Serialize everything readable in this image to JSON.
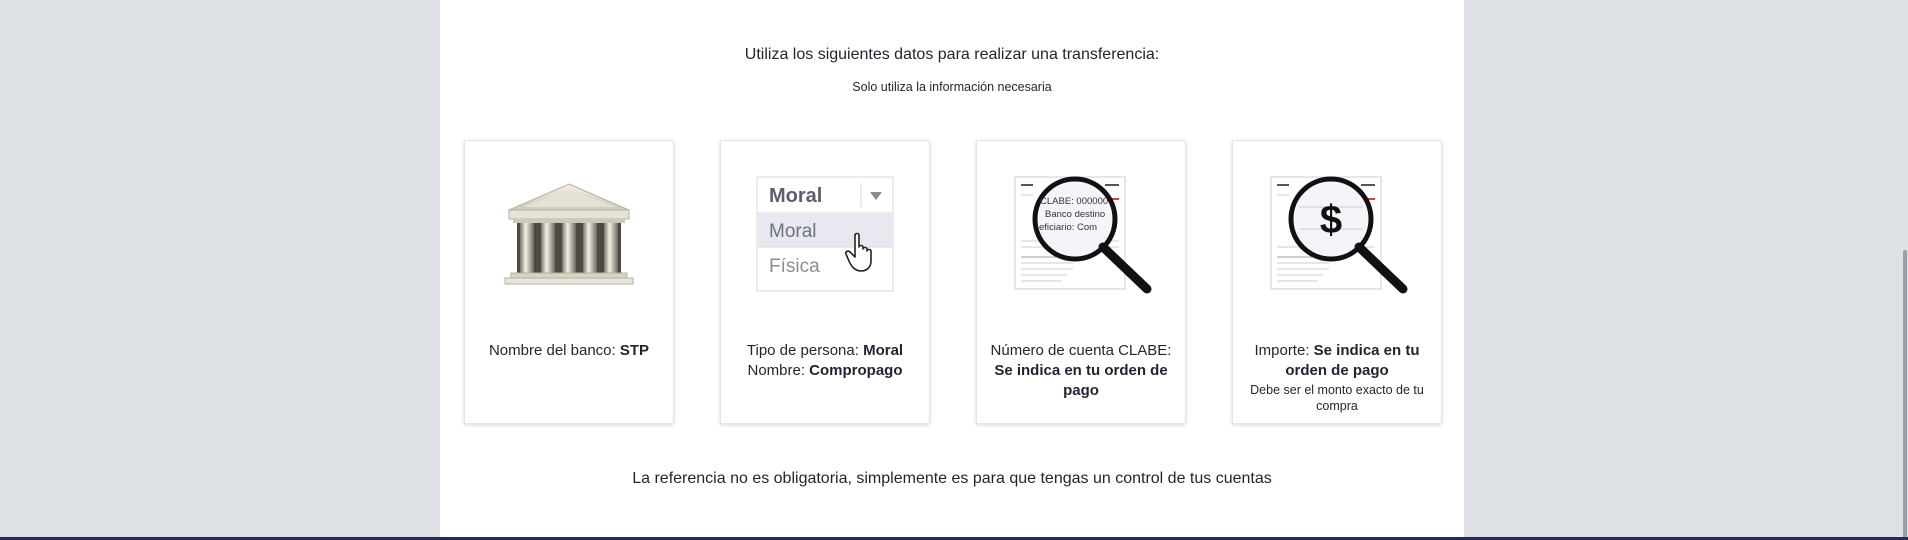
{
  "intro": {
    "title": "Utiliza los siguientes datos para realizar una transferencia:",
    "subtitle": "Solo utiliza la información necesaria"
  },
  "cards": [
    {
      "icon": "bank-icon",
      "label": "Nombre del banco: ",
      "value": "STP"
    },
    {
      "icon": "dropdown-illustration-icon",
      "dropdown_selected": "Moral",
      "dropdown_options": [
        "Moral",
        "Física"
      ],
      "label1": "Tipo de persona: ",
      "value1": "Moral",
      "label2": "Nombre: ",
      "value2": "Compropago"
    },
    {
      "icon": "magnifier-document-icon",
      "doc_lines": [
        "CLABE: 000000",
        "Banco destino",
        "eficiario: Com"
      ],
      "label": "Número de cuenta CLABE: ",
      "value": "Se indica en tu orden de pago"
    },
    {
      "icon": "magnifier-dollar-icon",
      "symbol": "$",
      "label": "Importe: ",
      "value": "Se indica en tu orden de pago",
      "note": "Debe ser el monto exacto de tu compra"
    }
  ],
  "footer_note": "La referencia no es obligatoria, simplemente es para que tengas un control de tus cuentas",
  "colors": {
    "page_bg": "#dde1e6",
    "panel_bg": "#ffffff",
    "text": "#1f2430",
    "accent_blue": "#1e88e5",
    "accent_red": "#e53935",
    "bottom_bar": "#262a54"
  }
}
